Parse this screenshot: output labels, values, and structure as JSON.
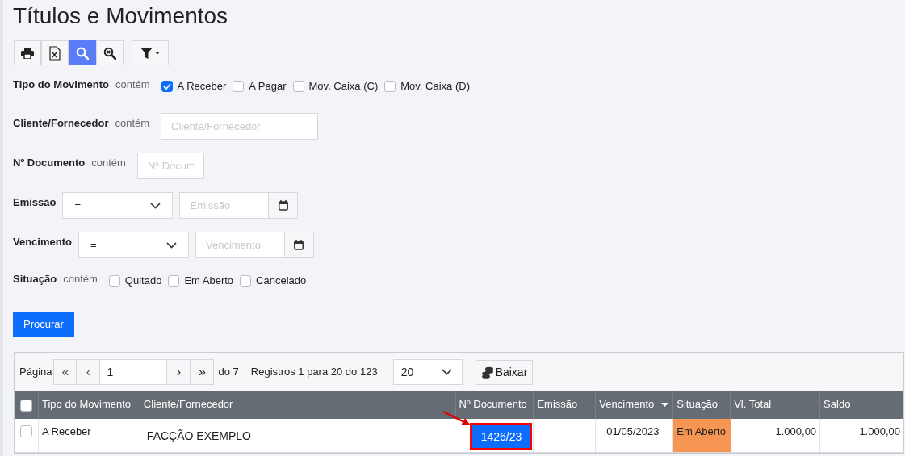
{
  "title": "Títulos e Movimentos",
  "toolbar": [
    {
      "kind": "print",
      "selected": false
    },
    {
      "kind": "excel",
      "selected": false
    },
    {
      "kind": "search",
      "selected": true
    },
    {
      "kind": "clear-search",
      "selected": false
    },
    {
      "kind": "filter",
      "selected": false
    }
  ],
  "filters": [
    {
      "kind": "checkboxes",
      "label": "Tipo do Movimento",
      "operator": "contém",
      "options": [
        {
          "label": "A Receber",
          "checked": true
        },
        {
          "label": "A Pagar",
          "checked": false
        },
        {
          "label": "Mov. Caixa (C)",
          "checked": false
        },
        {
          "label": "Mov. Caixa (D)",
          "checked": false
        }
      ]
    },
    {
      "kind": "text",
      "label": "Cliente/Fornecedor",
      "operator": "contém",
      "placeholder": "Cliente/Fornecedor"
    },
    {
      "kind": "text",
      "label": "Nº Documento",
      "operator": "contém",
      "placeholder": "Nº Docum"
    },
    {
      "kind": "date",
      "label": "Emissão",
      "comparison": "=",
      "placeholder": "Emissão"
    },
    {
      "kind": "date",
      "label": "Vencimento",
      "comparison": "=",
      "placeholder": "Vencimento"
    },
    {
      "kind": "checkboxes",
      "label": "Situação",
      "operator": "contém",
      "options": [
        {
          "label": "Quitado",
          "checked": false
        },
        {
          "label": "Em Aberto",
          "checked": false
        },
        {
          "label": "Cancelado",
          "checked": false
        }
      ]
    }
  ],
  "search_button": "Procurar",
  "pager": {
    "label": "Página",
    "first": "«",
    "prev": "‹",
    "page": "1",
    "next": "›",
    "last": "»",
    "of": "do 7",
    "records": "Registros 1 para 20 do 123",
    "page_size": "20",
    "settle_button": "Baixar"
  },
  "table": {
    "all_selected": false,
    "columns": [
      {
        "label": "Tipo do Movimento",
        "sorted": false
      },
      {
        "label": "Cliente/Fornecedor",
        "sorted": false
      },
      {
        "label": "Nº Documento",
        "sorted": false
      },
      {
        "label": "Emissão",
        "sorted": false
      },
      {
        "label": "Vencimento",
        "sorted": true
      },
      {
        "label": "Situação",
        "sorted": false
      },
      {
        "label": "Vl. Total",
        "sorted": false
      },
      {
        "label": "Saldo",
        "sorted": false
      }
    ],
    "rows": [
      {
        "checked": false,
        "type": "A Receber",
        "client": "FACÇÃO EXEMPLO",
        "document": "1426/23",
        "document_highlighted": true,
        "due": "01/05/2023",
        "status": "Em Aberto",
        "color": "#f79552",
        "total": "1.000,00",
        "balance": "1.000,00"
      }
    ]
  }
}
